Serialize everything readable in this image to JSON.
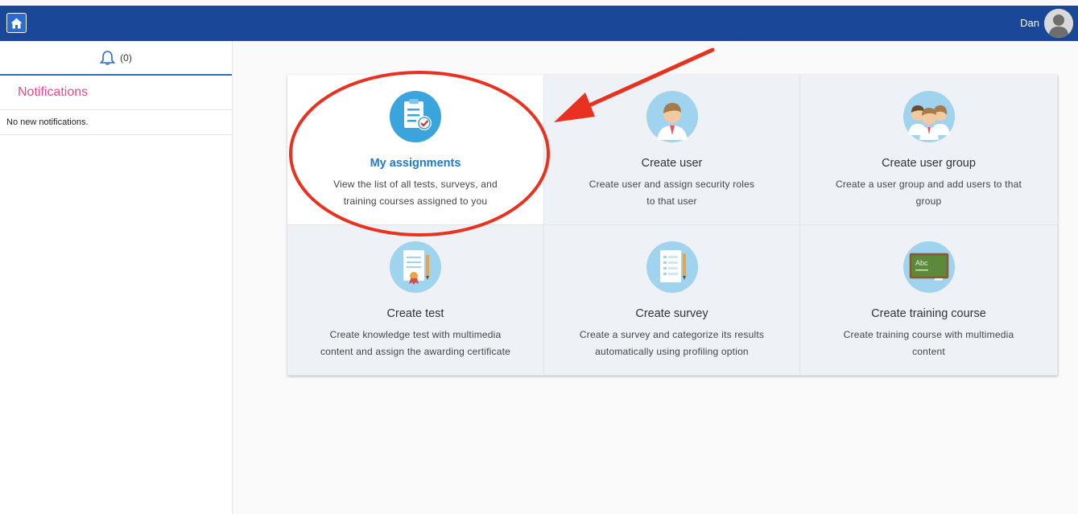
{
  "header": {
    "user_name": "Dan"
  },
  "sidebar": {
    "bell_count": "(0)",
    "notifications_title": "Notifications",
    "empty_text": "No new notifications."
  },
  "tiles": [
    {
      "title": "My assignments",
      "desc1": "View the list of all tests, surveys, and",
      "desc2": "training courses assigned to you"
    },
    {
      "title": "Create user",
      "desc1": "Create user and assign security roles",
      "desc2": "to that user"
    },
    {
      "title": "Create user group",
      "desc1": "Create a user group and add users to that",
      "desc2": "group"
    },
    {
      "title": "Create test",
      "desc1": "Create knowledge test with multimedia",
      "desc2": "content and assign the awarding certificate"
    },
    {
      "title": "Create survey",
      "desc1": "Create a survey and categorize its results",
      "desc2": "automatically using profiling option"
    },
    {
      "title": "Create training course",
      "desc1": "Create training course with multimedia",
      "desc2": "content"
    }
  ],
  "training_icon_text": "Abc",
  "colors": {
    "topbar": "#1b4799",
    "accent": "#1f7ad1",
    "pink": "#e74a8b",
    "annotation": "#e8321f"
  }
}
